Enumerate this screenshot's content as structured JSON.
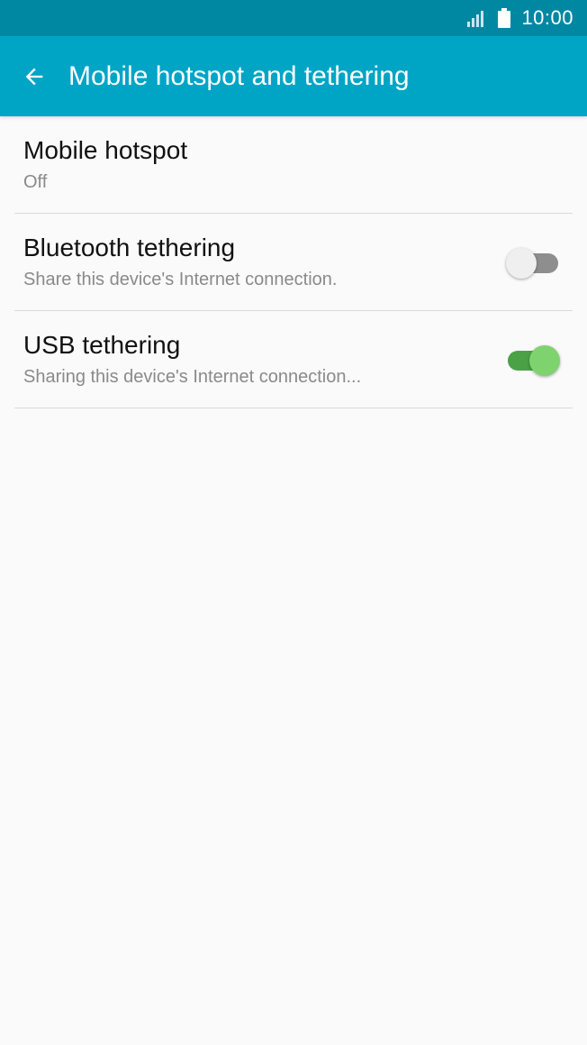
{
  "status_bar": {
    "time": "10:00",
    "icons": [
      "signal-icon",
      "battery-icon"
    ]
  },
  "app_bar": {
    "title": "Mobile hotspot and tethering",
    "back_icon": "arrow-left-icon"
  },
  "colors": {
    "status_bar": "#0088a3",
    "app_bar": "#00a5c5",
    "toggle_on_track": "#4ba146",
    "toggle_on_thumb": "#7ed36e",
    "toggle_off_track": "#8e8e8e",
    "toggle_off_thumb": "#efefef"
  },
  "items": [
    {
      "title": "Mobile hotspot",
      "subtitle": "Off"
    },
    {
      "title": "Bluetooth tethering",
      "subtitle": "Share this device's Internet connection.",
      "toggle_on": false
    },
    {
      "title": "USB tethering",
      "subtitle": "Sharing this device's Internet connection...",
      "toggle_on": true
    }
  ]
}
